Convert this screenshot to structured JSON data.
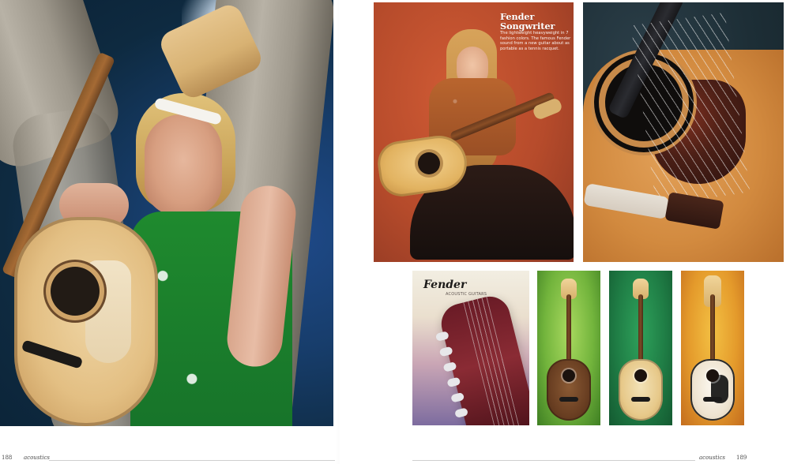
{
  "left_page": {
    "folio": {
      "page_number": "188",
      "section": "acoustics"
    }
  },
  "right_page": {
    "poster": {
      "title_line1": "Fender",
      "title_line2": "Songwriter",
      "body": "The lightweight heavyweight in 7 fashion colors. The famous Fender sound from a new guitar about as portable as a tennis racquet."
    },
    "catalog_card": {
      "logo": "Fender",
      "subtitle": "ACOUSTIC GUITARS"
    },
    "folio": {
      "section": "acoustics",
      "page_number": "189"
    }
  },
  "colors": {
    "paper": "#ffffff",
    "rule": "#cfcfcf",
    "poster_background": "#b64b2b"
  }
}
